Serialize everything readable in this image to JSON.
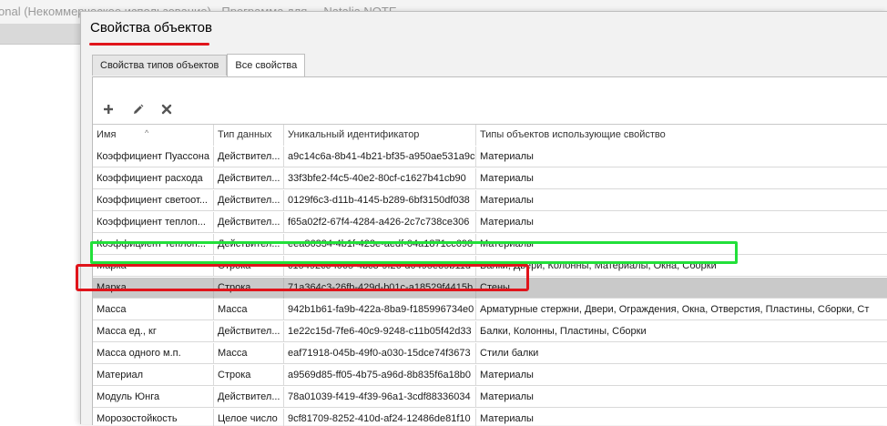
{
  "background_app": {
    "title": "onal (Некоммерческое использование) - Программа для ... Natalia NOTE"
  },
  "dialog": {
    "title": "Свойства объектов",
    "tabs": [
      {
        "label": "Свойства типов объектов",
        "active": false
      },
      {
        "label": "Все свойства",
        "active": true
      }
    ],
    "toolbar": {
      "add_icon": "plus-icon",
      "edit_icon": "pencil-icon",
      "delete_icon": "x-icon"
    }
  },
  "grid": {
    "columns": [
      "Имя",
      "Тип данных",
      "Уникальный идентификатор",
      "Типы объектов использующие свойство"
    ],
    "sort_indicator": "^",
    "rows": [
      {
        "name": "Коэффициент Пуассона",
        "type": "Действител...",
        "id": "a9c14c6a-8b41-4b21-bf35-a950ae531a9c",
        "objects": "Материалы"
      },
      {
        "name": "Коэффициент расхода",
        "type": "Действител...",
        "id": "33f3bfe2-f4c5-40e2-80cf-c1627b41cb90",
        "objects": "Материалы"
      },
      {
        "name": "Коэффициент светоот...",
        "type": "Действител...",
        "id": "0129f6c3-d11b-4145-b289-6bf3150df038",
        "objects": "Материалы"
      },
      {
        "name": "Коэффициент теплоп...",
        "type": "Действител...",
        "id": "f65a02f2-67f4-4284-a426-2c7c738ce306",
        "objects": "Материалы"
      },
      {
        "name": "Коэффициент теплоп...",
        "type": "Действител...",
        "id": "eea86334-4b1f-423e-aedf-04a1871cc698",
        "objects": "Материалы"
      },
      {
        "name": "Марка",
        "type": "Строка",
        "id": "c15492cc-f065-4bc3-9f26-d0495e39b11d",
        "objects": "Балки, Двери, Колонны, Материалы, Окна, Сборки"
      },
      {
        "name": "Марка",
        "type": "Строка",
        "id": "71a364c3-26fb-429d-b01c-a18529f4415b",
        "objects": "Стены"
      },
      {
        "name": "Масса",
        "type": "Масса",
        "id": "942b1b61-fa9b-422a-8ba9-f185996734e0",
        "objects": "Арматурные стержни, Двери, Ограждения, Окна, Отверстия, Пластины, Сборки, Ст"
      },
      {
        "name": "Масса ед., кг",
        "type": "Действител...",
        "id": "1e22c15d-7fe6-40c9-9248-c11b05f42d33",
        "objects": "Балки, Колонны, Пластины, Сборки"
      },
      {
        "name": "Масса одного м.п.",
        "type": "Масса",
        "id": "eaf71918-045b-49f0-a030-15dce74f3673",
        "objects": "Стили балки"
      },
      {
        "name": "Материал",
        "type": "Строка",
        "id": "a9569d85-ff05-4b75-a96d-8b835f6a18b0",
        "objects": "Материалы"
      },
      {
        "name": "Модуль Юнга",
        "type": "Действител...",
        "id": "78a01039-f419-4f39-96a1-3cdf88336034",
        "objects": "Материалы"
      },
      {
        "name": "Морозостойкость",
        "type": "Целое число",
        "id": "9cf81709-8252-410d-af24-12486de81f10",
        "objects": "Материалы"
      },
      {
        "name": "",
        "type": "",
        "id": "",
        "objects": ""
      }
    ],
    "selected_row": 6
  },
  "colors": {
    "highlight_green": "#22e03a",
    "highlight_red": "#e0141b",
    "selected_row": "#c9c9c9"
  }
}
